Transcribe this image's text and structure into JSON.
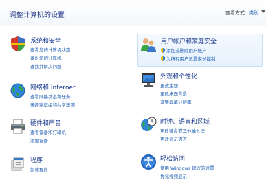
{
  "header": {
    "title": "调整计算机的设置",
    "view_by_label": "查看方式:",
    "view_by_value": "类别"
  },
  "categories": [
    {
      "title": "系统和安全",
      "icon": "system-security-icon",
      "links": [
        "查看您的计算机状态",
        "备份您的计算机",
        "查找并解决问题"
      ]
    },
    {
      "title": "网络和 Internet",
      "icon": "network-globe-icon",
      "links": [
        "查看网络状态和任务",
        "选择家庭组和共享选项"
      ]
    },
    {
      "title": "硬件和声音",
      "icon": "printer-icon",
      "links": [
        "查看设备和打印机",
        "添加设备"
      ]
    },
    {
      "title": "程序",
      "icon": "programs-icon",
      "links": [
        "卸载程序"
      ]
    },
    {
      "title": "用户帐户和家庭安全",
      "icon": "users-icon",
      "links": [
        "添加或删除用户帐户",
        "为所有用户设置家长控制"
      ]
    },
    {
      "title": "外观和个性化",
      "icon": "monitor-icon",
      "links": [
        "更改主题",
        "更改桌面背景",
        "调整屏幕分辨率"
      ]
    },
    {
      "title": "时钟、语言和区域",
      "icon": "clock-globe-icon",
      "links": [
        "更改键盘或其他输入法",
        "更改显示语言"
      ]
    },
    {
      "title": "轻松访问",
      "icon": "ease-of-access-icon",
      "links": [
        "使用 Windows 建议的设置",
        "优化视频显示"
      ]
    }
  ],
  "colors": {
    "title": "#1e3287",
    "category": "#1a3a8f",
    "link": "#1e5fb4"
  }
}
